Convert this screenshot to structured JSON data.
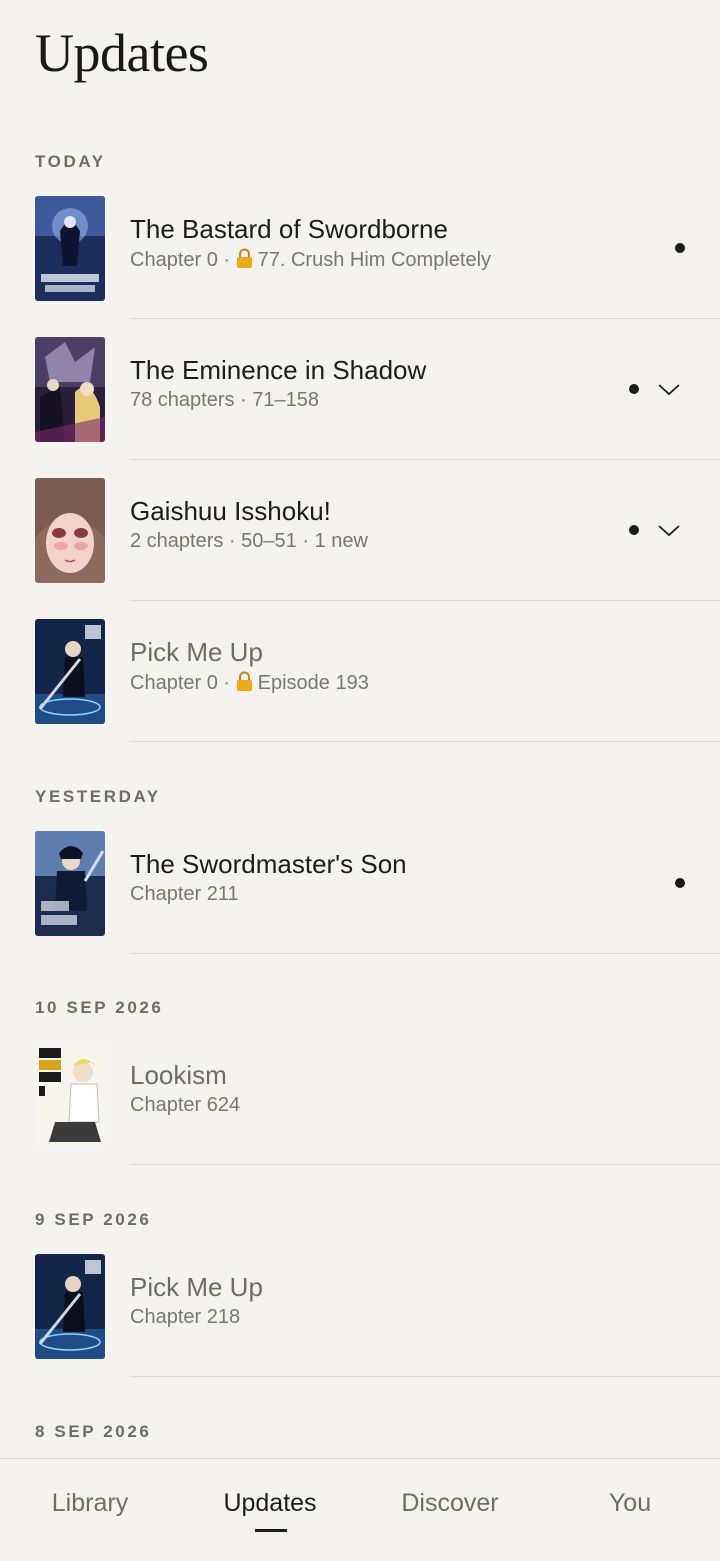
{
  "page_title": "Updates",
  "colors": {
    "background": "#f4f3ef",
    "text": "#1e1d1b",
    "muted": "#7a7771",
    "lock": "#f0a818"
  },
  "sections": [
    {
      "label": "TODAY",
      "items": [
        {
          "title": "The Bastard of Swordborne",
          "subtitle_prefix": "Chapter 0 · ",
          "locked": true,
          "subtitle_suffix": "77. Crush Him Completely",
          "unread": true,
          "expandable": false
        },
        {
          "title": "The Eminence in Shadow",
          "subtitle_prefix": "78 chapters · 71–158",
          "locked": false,
          "subtitle_suffix": "",
          "unread": true,
          "expandable": true
        },
        {
          "title": "Gaishuu Isshoku!",
          "subtitle_prefix": "2 chapters · 50–51 · 1 new",
          "locked": false,
          "subtitle_suffix": "",
          "unread": true,
          "expandable": true
        },
        {
          "title": "Pick Me Up",
          "subtitle_prefix": "Chapter 0 · ",
          "locked": true,
          "subtitle_suffix": "Episode 193",
          "unread": false,
          "expandable": false
        }
      ]
    },
    {
      "label": "YESTERDAY",
      "items": [
        {
          "title": "The Swordmaster's Son",
          "subtitle_prefix": "Chapter 211",
          "locked": false,
          "subtitle_suffix": "",
          "unread": true,
          "expandable": false
        }
      ]
    },
    {
      "label": "10 SEP 2026",
      "items": [
        {
          "title": "Lookism",
          "subtitle_prefix": "Chapter 624",
          "locked": false,
          "subtitle_suffix": "",
          "unread": false,
          "expandable": false
        }
      ]
    },
    {
      "label": "9 SEP 2026",
      "items": [
        {
          "title": "Pick Me Up",
          "subtitle_prefix": "Chapter 218",
          "locked": false,
          "subtitle_suffix": "",
          "unread": false,
          "expandable": false
        }
      ]
    },
    {
      "label": "8 SEP 2026",
      "items": []
    }
  ],
  "tabs": [
    {
      "label": "Library",
      "active": false
    },
    {
      "label": "Updates",
      "active": true
    },
    {
      "label": "Discover",
      "active": false
    },
    {
      "label": "You",
      "active": false
    }
  ]
}
